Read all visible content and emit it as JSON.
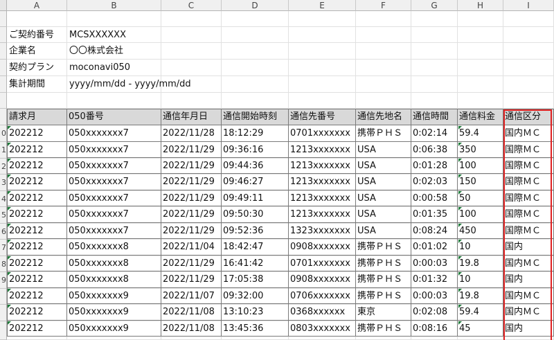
{
  "columns": [
    "A",
    "B",
    "C",
    "D",
    "E",
    "F",
    "G",
    "H",
    "I"
  ],
  "row_numbers": [
    "",
    "",
    "",
    "",
    "",
    "",
    "",
    "",
    "0",
    "1",
    "2",
    "3",
    "4",
    "5",
    "6",
    "7",
    "8",
    "9"
  ],
  "info": [
    {
      "label": "ご契約番号",
      "value": "MCSXXXXXX"
    },
    {
      "label": "企業名",
      "value": "〇〇株式会社"
    },
    {
      "label": "契約プラン",
      "value": "moconavi050"
    },
    {
      "label": "集計期間",
      "value": "yyyy/mm/dd - yyyy/mm/dd"
    }
  ],
  "table": {
    "headers": [
      "請求月",
      "050番号",
      "通信年月日",
      "通信開始時刻",
      "通信先番号",
      "通信先地名",
      "通信時間",
      "通信料金",
      "通信区分"
    ],
    "rows": [
      [
        "202212",
        "050xxxxxxx7",
        "2022/11/28",
        "18:12:29",
        "0701xxxxxxx",
        "携帯ＰＨＳ",
        "0:02:14",
        "59.4",
        "国内ＭＣ"
      ],
      [
        "202212",
        "050xxxxxxx7",
        "2022/11/29",
        "09:36:16",
        "1213xxxxxxx",
        "USA",
        "0:06:38",
        "350",
        "国際ＭＣ"
      ],
      [
        "202212",
        "050xxxxxxx7",
        "2022/11/29",
        "09:44:36",
        "1213xxxxxxx",
        "USA",
        "0:01:28",
        "100",
        "国際ＭＣ"
      ],
      [
        "202212",
        "050xxxxxxx7",
        "2022/11/29",
        "09:46:27",
        "1213xxxxxxx",
        "USA",
        "0:02:03",
        "150",
        "国際ＭＣ"
      ],
      [
        "202212",
        "050xxxxxxx7",
        "2022/11/29",
        "09:49:11",
        "1213xxxxxxx",
        "USA",
        "0:00:58",
        "50",
        "国際ＭＣ"
      ],
      [
        "202212",
        "050xxxxxxx7",
        "2022/11/29",
        "09:50:30",
        "1213xxxxxxx",
        "USA",
        "0:01:35",
        "100",
        "国際ＭＣ"
      ],
      [
        "202212",
        "050xxxxxxx7",
        "2022/11/29",
        "09:52:36",
        "1323xxxxxxx",
        "USA",
        "0:08:24",
        "450",
        "国際ＭＣ"
      ],
      [
        "202212",
        "050xxxxxxx8",
        "2022/11/04",
        "18:42:47",
        "0908xxxxxxx",
        "携帯ＰＨＳ",
        "0:01:02",
        "10",
        "国内"
      ],
      [
        "202212",
        "050xxxxxxx8",
        "2022/11/29",
        "16:41:42",
        "0701xxxxxxx",
        "携帯ＰＨＳ",
        "0:00:03",
        "19.8",
        "国内ＭＣ"
      ],
      [
        "202212",
        "050xxxxxxx8",
        "2022/11/29",
        "17:05:38",
        "0908xxxxxxx",
        "携帯ＰＨＳ",
        "0:01:32",
        "10",
        "国内"
      ],
      [
        "202212",
        "050xxxxxxx9",
        "2022/11/07",
        "09:32:00",
        "0706xxxxxxx",
        "携帯ＰＨＳ",
        "0:00:03",
        "19.8",
        "国内ＭＣ"
      ],
      [
        "202212",
        "050xxxxxxx9",
        "2022/11/08",
        "13:10:23",
        "0368xxxxxx",
        "東京",
        "0:02:08",
        "59.4",
        "国内ＭＣ"
      ],
      [
        "202212",
        "050xxxxxxx9",
        "2022/11/08",
        "13:45:36",
        "0803xxxxxxx",
        "携帯ＰＨＳ",
        "0:08:16",
        "45",
        "国内"
      ]
    ]
  },
  "colors": {
    "header_fill": "#d9d9d9",
    "highlight": "#e02020",
    "indicator": "#1f7a3a"
  }
}
